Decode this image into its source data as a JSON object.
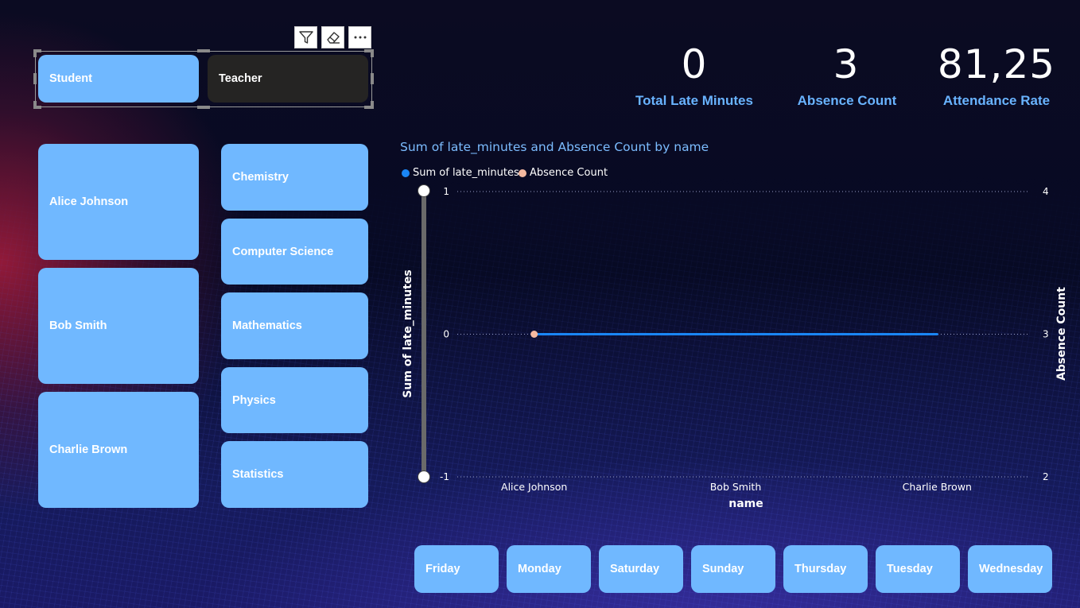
{
  "toolbar": {
    "icons": [
      "filter-icon",
      "eraser-icon",
      "more-options-icon"
    ]
  },
  "role_slicer": {
    "options": [
      {
        "label": "Student",
        "selected": false
      },
      {
        "label": "Teacher",
        "selected": true
      }
    ]
  },
  "kpis": [
    {
      "value": "0",
      "label": "Total Late Minutes"
    },
    {
      "value": "3",
      "label": "Absence Count"
    },
    {
      "value": "81,25",
      "label": "Attendance Rate"
    }
  ],
  "name_slicer": {
    "options": [
      "Alice Johnson",
      "Bob Smith",
      "Charlie Brown"
    ]
  },
  "subject_slicer": {
    "options": [
      "Chemistry",
      "Computer Science",
      "Mathematics",
      "Physics",
      "Statistics"
    ]
  },
  "day_slicer": {
    "options": [
      "Friday",
      "Monday",
      "Saturday",
      "Sunday",
      "Thursday",
      "Tuesday",
      "Wednesday"
    ]
  },
  "colors": {
    "button_fill": "#70b8ff",
    "selected_fill": "#252423",
    "accent_text": "#69b3ff",
    "series_late": "#1a86f5",
    "series_absence": "#f4b9a0"
  },
  "chart_data": {
    "type": "line",
    "title": "Sum of late_minutes and Absence Count by name",
    "categories": [
      "Alice Johnson",
      "Bob Smith",
      "Charlie Brown"
    ],
    "xlabel": "name",
    "ylabel": "Sum of late_minutes",
    "y2label": "Absence Count",
    "ylim": [
      -1,
      1
    ],
    "y2lim": [
      2,
      4
    ],
    "yticks": [
      "1",
      "0",
      "-1"
    ],
    "y2ticks": [
      "4",
      "3",
      "2"
    ],
    "legend_position": "top-left",
    "series": [
      {
        "name": "Sum of late_minutes",
        "axis": "left",
        "values": [
          0,
          0,
          0
        ]
      },
      {
        "name": "Absence Count",
        "axis": "right",
        "values": [
          3,
          null,
          null
        ]
      }
    ]
  }
}
